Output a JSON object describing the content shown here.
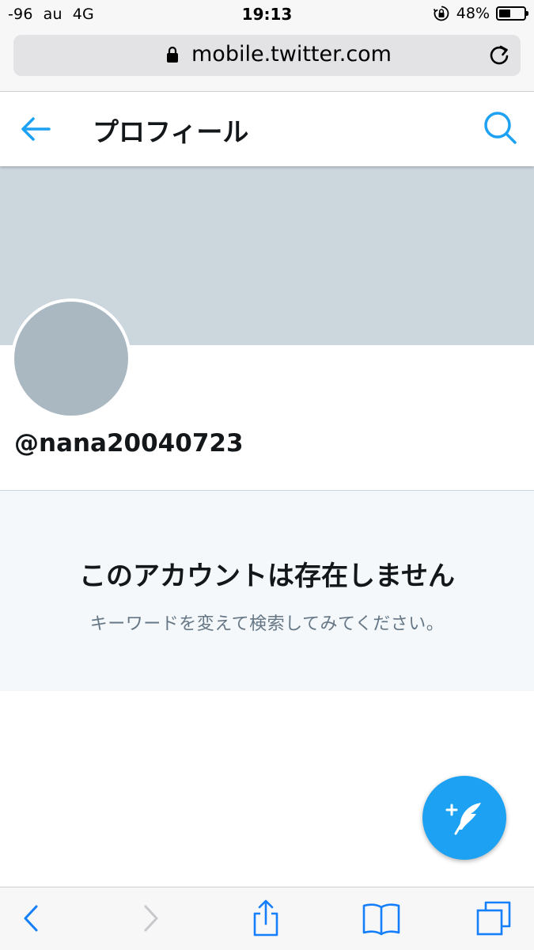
{
  "status_bar": {
    "signal": "-96",
    "carrier": "au",
    "network": "4G",
    "time": "19:13",
    "battery_percent": "48%",
    "battery_level": 0.48
  },
  "browser": {
    "url": "mobile.twitter.com"
  },
  "header": {
    "title": "プロフィール"
  },
  "profile": {
    "handle": "@nana20040723"
  },
  "empty_state": {
    "title": "このアカウントは存在しません",
    "subtitle": "キーワードを変えて検索してみてください。"
  },
  "colors": {
    "accent": "#1da1f2",
    "banner": "#ccd6dd",
    "avatar": "#aab8c2",
    "empty_bg": "#f5f8fa",
    "subtext": "#657786",
    "ios_blue": "#147efb"
  },
  "icons": {
    "back": "arrow-left-icon",
    "search": "search-icon",
    "compose": "compose-tweet-icon",
    "lock": "lock-icon",
    "reload": "reload-icon",
    "orientation_lock": "orientation-lock-icon",
    "safari_back": "chevron-left-icon",
    "safari_forward": "chevron-right-icon",
    "share": "share-icon",
    "bookmarks": "book-icon",
    "tabs": "tabs-icon"
  }
}
